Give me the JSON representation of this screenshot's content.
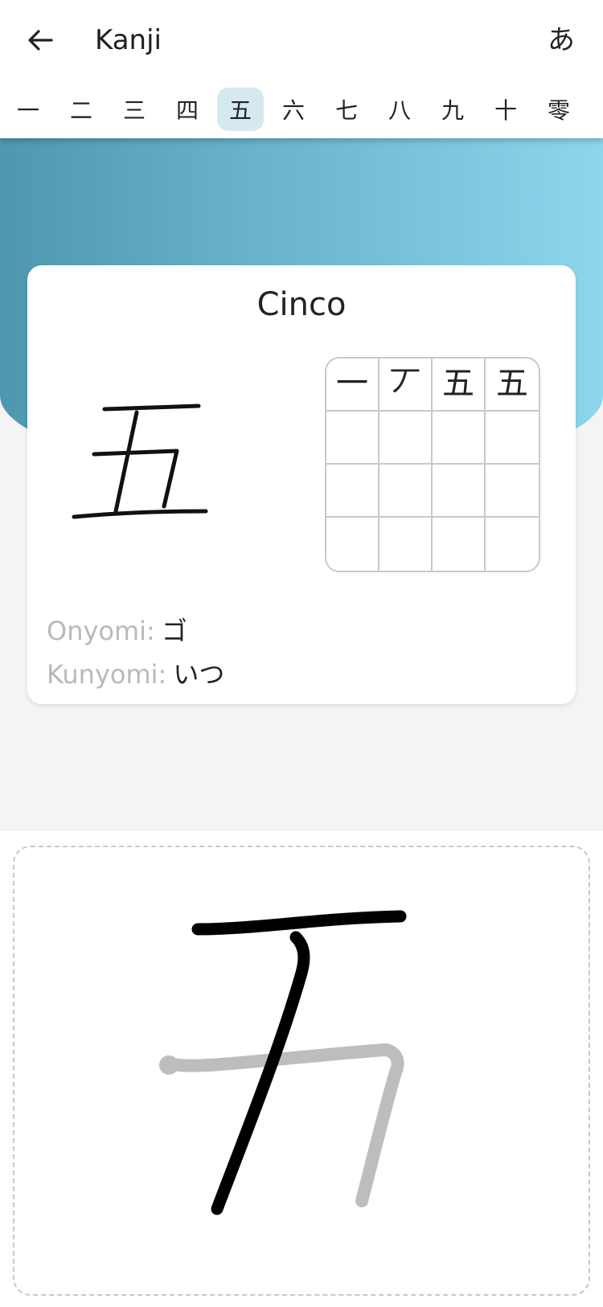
{
  "header": {
    "back_icon": "arrow-left-icon",
    "title": "Kanji",
    "kana_toggle": "あ"
  },
  "tabs": [
    {
      "label": "一",
      "active": false
    },
    {
      "label": "二",
      "active": false
    },
    {
      "label": "三",
      "active": false
    },
    {
      "label": "四",
      "active": false
    },
    {
      "label": "五",
      "active": true
    },
    {
      "label": "六",
      "active": false
    },
    {
      "label": "七",
      "active": false
    },
    {
      "label": "八",
      "active": false
    },
    {
      "label": "九",
      "active": false
    },
    {
      "label": "十",
      "active": false
    },
    {
      "label": "零",
      "active": false
    }
  ],
  "card": {
    "meaning": "Cinco",
    "kanji": "五",
    "stroke_order": [
      "一",
      "丆",
      "五",
      "五"
    ],
    "onyomi_label": "Onyomi:",
    "onyomi_value": "ゴ",
    "kunyomi_label": "Kunyomi:",
    "kunyomi_value": "いつ"
  },
  "colors": {
    "gradient_start": "#4e97b0",
    "gradient_end": "#8dd6ec",
    "active_tab_bg": "#d6e8f0",
    "drawn_stroke": "#000000",
    "guide_stroke": "#bdbdbd",
    "label_gray": "#b9b9b9"
  }
}
